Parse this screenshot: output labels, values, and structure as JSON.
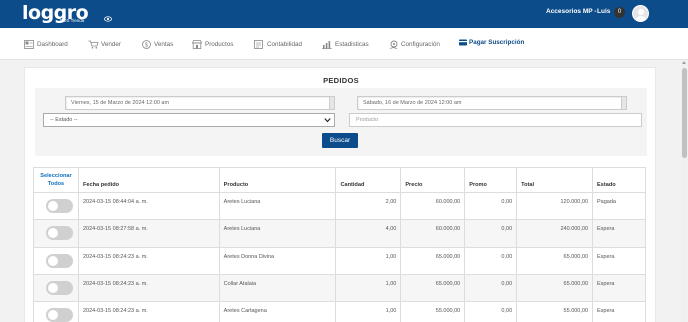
{
  "brand": {
    "logo_text": "loggro",
    "logo_sub": "POS Tienda",
    "icon": "eye-icon"
  },
  "header": {
    "store": "Accesorios MP -",
    "user": "Luis",
    "notifications": "0",
    "avatar_icon": "user-avatar-icon"
  },
  "nav": {
    "items": [
      {
        "label": "Dashboard",
        "icon": "dashboard-icon"
      },
      {
        "label": "Vender",
        "icon": "cart-icon"
      },
      {
        "label": "Ventas",
        "icon": "dollar-circle-icon"
      },
      {
        "label": "Productos",
        "icon": "shop-icon"
      },
      {
        "label": "Contabilidad",
        "icon": "ledger-icon"
      },
      {
        "label": "Estadisticas",
        "icon": "bar-chart-icon"
      },
      {
        "label": "Configuración",
        "icon": "gear-hand-icon"
      },
      {
        "label": "Pagar Suscripción",
        "icon": "credit-card-icon"
      }
    ]
  },
  "page": {
    "title": "PEDIDOS"
  },
  "filters": {
    "date_from": "Viernes, 15 de Marzo de 2024 12:00 am",
    "date_to": "Sábado, 16 de Marzo de 2024 12:00 am",
    "estado": "-- Estado --",
    "producto_placeholder": "Producto",
    "buscar_label": "Buscar"
  },
  "table": {
    "columns": [
      "Seleccionar Todos",
      "Fecha pedido",
      "Producto",
      "Cantidad",
      "Precio",
      "Promo",
      "Total",
      "Estado"
    ],
    "rows": [
      {
        "fecha": "2024-03-15 08:44:04 a. m.",
        "producto": "Aretes Luciana",
        "cantidad": "2,00",
        "precio": "60.000,00",
        "promo": "0,00",
        "total": "120.000,00",
        "estado": "Pagada"
      },
      {
        "fecha": "2024-03-15 08:27:58 a. m.",
        "producto": "Aretes Luciana",
        "cantidad": "4,00",
        "precio": "60.000,00",
        "promo": "0,00",
        "total": "240.000,00",
        "estado": "Espera"
      },
      {
        "fecha": "2024-03-15 08:24:23 a. m.",
        "producto": "Aretes Donna Divina",
        "cantidad": "1,00",
        "precio": "65.000,00",
        "promo": "0,00",
        "total": "65.000,00",
        "estado": "Espera"
      },
      {
        "fecha": "2024-03-15 08:24:23 a. m.",
        "producto": "Collar Atalaia",
        "cantidad": "1,00",
        "precio": "65.000,00",
        "promo": "0,00",
        "total": "65.000,00",
        "estado": "Espera"
      },
      {
        "fecha": "2024-03-15 08:24:23 a. m.",
        "producto": "Aretes Cartagena",
        "cantidad": "1,00",
        "precio": "55.000,00",
        "promo": "0,00",
        "total": "55.000,00",
        "estado": "Espera"
      }
    ]
  },
  "colors": {
    "brand_blue": "#0d4c8a",
    "link_blue": "#0d6fc1"
  }
}
